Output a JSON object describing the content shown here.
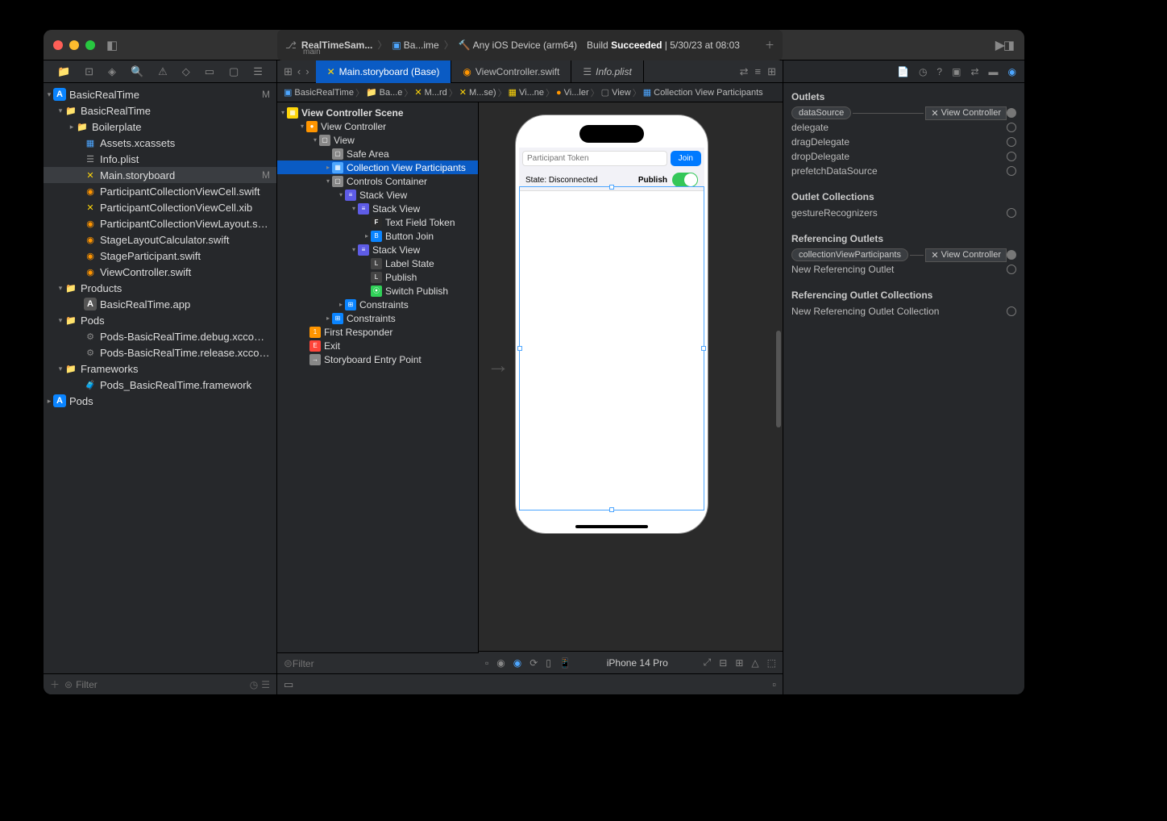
{
  "titlebar": {
    "project_name": "RealTimeSam...",
    "branch": "main",
    "scheme": "Ba...ime",
    "destination": "Any iOS Device (arm64)",
    "build_status_prefix": "Build ",
    "build_status_word": "Succeeded",
    "build_status_time": " | 5/30/23 at 08:03"
  },
  "navigator": {
    "filter_placeholder": "Filter",
    "tree": {
      "root": {
        "label": "BasicRealTime",
        "status": "M"
      },
      "target": {
        "label": "BasicRealTime"
      },
      "boilerplate": {
        "label": "Boilerplate"
      },
      "assets": {
        "label": "Assets.xcassets"
      },
      "infoplist": {
        "label": "Info.plist"
      },
      "mainsb": {
        "label": "Main.storyboard",
        "status": "M"
      },
      "pcellswift": {
        "label": "ParticipantCollectionViewCell.swift"
      },
      "pcellxib": {
        "label": "ParticipantCollectionViewCell.xib"
      },
      "playout": {
        "label": "ParticipantCollectionViewLayout.swift"
      },
      "stagecalc": {
        "label": "StageLayoutCalculator.swift"
      },
      "stagepart": {
        "label": "StageParticipant.swift"
      },
      "vc": {
        "label": "ViewController.swift"
      },
      "products": {
        "label": "Products"
      },
      "app": {
        "label": "BasicRealTime.app"
      },
      "pods_group": {
        "label": "Pods"
      },
      "pods_debug": {
        "label": "Pods-BasicRealTime.debug.xcconfig"
      },
      "pods_release": {
        "label": "Pods-BasicRealTime.release.xcconfig"
      },
      "frameworks": {
        "label": "Frameworks"
      },
      "pods_fw": {
        "label": "Pods_BasicRealTime.framework"
      },
      "pods_proj": {
        "label": "Pods"
      }
    }
  },
  "file_tabs": {
    "tab1": "Main.storyboard (Base)",
    "tab2": "ViewController.swift",
    "tab3": "Info.plist"
  },
  "jumpbar": {
    "i1": "BasicRealTime",
    "i2": "Ba...e",
    "i3": "M...rd",
    "i4": "M...se)",
    "i5": "Vi...ne",
    "i6": "Vi...ler",
    "i7": "View",
    "i8": "Collection View Participants"
  },
  "outline": {
    "scene": "View Controller Scene",
    "vc": "View Controller",
    "view": "View",
    "safe": "Safe Area",
    "cv": "Collection View Participants",
    "controls": "Controls Container",
    "stack1": "Stack View",
    "stack2": "Stack View",
    "tf": "Text Field Token",
    "btn": "Button Join",
    "stack3": "Stack View",
    "lblstate": "Label State",
    "lblpub": "Publish",
    "sw": "Switch Publish",
    "constr1": "Constraints",
    "constr2": "Constraints",
    "fr": "First Responder",
    "exit": "Exit",
    "entry": "Storyboard Entry Point",
    "filter_placeholder": "Filter"
  },
  "canvas": {
    "token_placeholder": "Participant Token",
    "join_label": "Join",
    "state_label": "State: Disconnected",
    "publish_label": "Publish",
    "device_name": "iPhone 14 Pro"
  },
  "inspector": {
    "outlets_header": "Outlets",
    "datasource": "dataSource",
    "delegate": "delegate",
    "dragdelegate": "dragDelegate",
    "dropdelegate": "dropDelegate",
    "prefetch": "prefetchDataSource",
    "outlet_collections_header": "Outlet Collections",
    "gesture": "gestureRecognizers",
    "ref_outlets_header": "Referencing Outlets",
    "cvparticipants": "collectionViewParticipants",
    "newref": "New Referencing Outlet",
    "ref_coll_header": "Referencing Outlet Collections",
    "newrefcoll": "New Referencing Outlet Collection",
    "dest_vc": "View Controller"
  }
}
